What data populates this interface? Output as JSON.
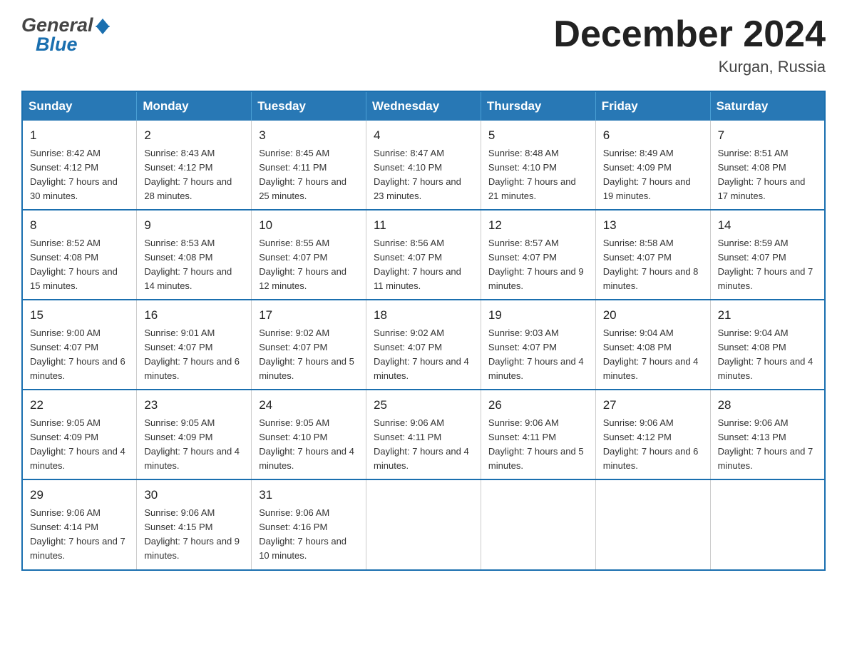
{
  "header": {
    "logo_general": "General",
    "logo_blue": "Blue",
    "month_title": "December 2024",
    "location": "Kurgan, Russia"
  },
  "days_of_week": [
    "Sunday",
    "Monday",
    "Tuesday",
    "Wednesday",
    "Thursday",
    "Friday",
    "Saturday"
  ],
  "weeks": [
    [
      {
        "day": "1",
        "sunrise": "Sunrise: 8:42 AM",
        "sunset": "Sunset: 4:12 PM",
        "daylight": "Daylight: 7 hours and 30 minutes."
      },
      {
        "day": "2",
        "sunrise": "Sunrise: 8:43 AM",
        "sunset": "Sunset: 4:12 PM",
        "daylight": "Daylight: 7 hours and 28 minutes."
      },
      {
        "day": "3",
        "sunrise": "Sunrise: 8:45 AM",
        "sunset": "Sunset: 4:11 PM",
        "daylight": "Daylight: 7 hours and 25 minutes."
      },
      {
        "day": "4",
        "sunrise": "Sunrise: 8:47 AM",
        "sunset": "Sunset: 4:10 PM",
        "daylight": "Daylight: 7 hours and 23 minutes."
      },
      {
        "day": "5",
        "sunrise": "Sunrise: 8:48 AM",
        "sunset": "Sunset: 4:10 PM",
        "daylight": "Daylight: 7 hours and 21 minutes."
      },
      {
        "day": "6",
        "sunrise": "Sunrise: 8:49 AM",
        "sunset": "Sunset: 4:09 PM",
        "daylight": "Daylight: 7 hours and 19 minutes."
      },
      {
        "day": "7",
        "sunrise": "Sunrise: 8:51 AM",
        "sunset": "Sunset: 4:08 PM",
        "daylight": "Daylight: 7 hours and 17 minutes."
      }
    ],
    [
      {
        "day": "8",
        "sunrise": "Sunrise: 8:52 AM",
        "sunset": "Sunset: 4:08 PM",
        "daylight": "Daylight: 7 hours and 15 minutes."
      },
      {
        "day": "9",
        "sunrise": "Sunrise: 8:53 AM",
        "sunset": "Sunset: 4:08 PM",
        "daylight": "Daylight: 7 hours and 14 minutes."
      },
      {
        "day": "10",
        "sunrise": "Sunrise: 8:55 AM",
        "sunset": "Sunset: 4:07 PM",
        "daylight": "Daylight: 7 hours and 12 minutes."
      },
      {
        "day": "11",
        "sunrise": "Sunrise: 8:56 AM",
        "sunset": "Sunset: 4:07 PM",
        "daylight": "Daylight: 7 hours and 11 minutes."
      },
      {
        "day": "12",
        "sunrise": "Sunrise: 8:57 AM",
        "sunset": "Sunset: 4:07 PM",
        "daylight": "Daylight: 7 hours and 9 minutes."
      },
      {
        "day": "13",
        "sunrise": "Sunrise: 8:58 AM",
        "sunset": "Sunset: 4:07 PM",
        "daylight": "Daylight: 7 hours and 8 minutes."
      },
      {
        "day": "14",
        "sunrise": "Sunrise: 8:59 AM",
        "sunset": "Sunset: 4:07 PM",
        "daylight": "Daylight: 7 hours and 7 minutes."
      }
    ],
    [
      {
        "day": "15",
        "sunrise": "Sunrise: 9:00 AM",
        "sunset": "Sunset: 4:07 PM",
        "daylight": "Daylight: 7 hours and 6 minutes."
      },
      {
        "day": "16",
        "sunrise": "Sunrise: 9:01 AM",
        "sunset": "Sunset: 4:07 PM",
        "daylight": "Daylight: 7 hours and 6 minutes."
      },
      {
        "day": "17",
        "sunrise": "Sunrise: 9:02 AM",
        "sunset": "Sunset: 4:07 PM",
        "daylight": "Daylight: 7 hours and 5 minutes."
      },
      {
        "day": "18",
        "sunrise": "Sunrise: 9:02 AM",
        "sunset": "Sunset: 4:07 PM",
        "daylight": "Daylight: 7 hours and 4 minutes."
      },
      {
        "day": "19",
        "sunrise": "Sunrise: 9:03 AM",
        "sunset": "Sunset: 4:07 PM",
        "daylight": "Daylight: 7 hours and 4 minutes."
      },
      {
        "day": "20",
        "sunrise": "Sunrise: 9:04 AM",
        "sunset": "Sunset: 4:08 PM",
        "daylight": "Daylight: 7 hours and 4 minutes."
      },
      {
        "day": "21",
        "sunrise": "Sunrise: 9:04 AM",
        "sunset": "Sunset: 4:08 PM",
        "daylight": "Daylight: 7 hours and 4 minutes."
      }
    ],
    [
      {
        "day": "22",
        "sunrise": "Sunrise: 9:05 AM",
        "sunset": "Sunset: 4:09 PM",
        "daylight": "Daylight: 7 hours and 4 minutes."
      },
      {
        "day": "23",
        "sunrise": "Sunrise: 9:05 AM",
        "sunset": "Sunset: 4:09 PM",
        "daylight": "Daylight: 7 hours and 4 minutes."
      },
      {
        "day": "24",
        "sunrise": "Sunrise: 9:05 AM",
        "sunset": "Sunset: 4:10 PM",
        "daylight": "Daylight: 7 hours and 4 minutes."
      },
      {
        "day": "25",
        "sunrise": "Sunrise: 9:06 AM",
        "sunset": "Sunset: 4:11 PM",
        "daylight": "Daylight: 7 hours and 4 minutes."
      },
      {
        "day": "26",
        "sunrise": "Sunrise: 9:06 AM",
        "sunset": "Sunset: 4:11 PM",
        "daylight": "Daylight: 7 hours and 5 minutes."
      },
      {
        "day": "27",
        "sunrise": "Sunrise: 9:06 AM",
        "sunset": "Sunset: 4:12 PM",
        "daylight": "Daylight: 7 hours and 6 minutes."
      },
      {
        "day": "28",
        "sunrise": "Sunrise: 9:06 AM",
        "sunset": "Sunset: 4:13 PM",
        "daylight": "Daylight: 7 hours and 7 minutes."
      }
    ],
    [
      {
        "day": "29",
        "sunrise": "Sunrise: 9:06 AM",
        "sunset": "Sunset: 4:14 PM",
        "daylight": "Daylight: 7 hours and 7 minutes."
      },
      {
        "day": "30",
        "sunrise": "Sunrise: 9:06 AM",
        "sunset": "Sunset: 4:15 PM",
        "daylight": "Daylight: 7 hours and 9 minutes."
      },
      {
        "day": "31",
        "sunrise": "Sunrise: 9:06 AM",
        "sunset": "Sunset: 4:16 PM",
        "daylight": "Daylight: 7 hours and 10 minutes."
      },
      {
        "day": "",
        "sunrise": "",
        "sunset": "",
        "daylight": ""
      },
      {
        "day": "",
        "sunrise": "",
        "sunset": "",
        "daylight": ""
      },
      {
        "day": "",
        "sunrise": "",
        "sunset": "",
        "daylight": ""
      },
      {
        "day": "",
        "sunrise": "",
        "sunset": "",
        "daylight": ""
      }
    ]
  ]
}
